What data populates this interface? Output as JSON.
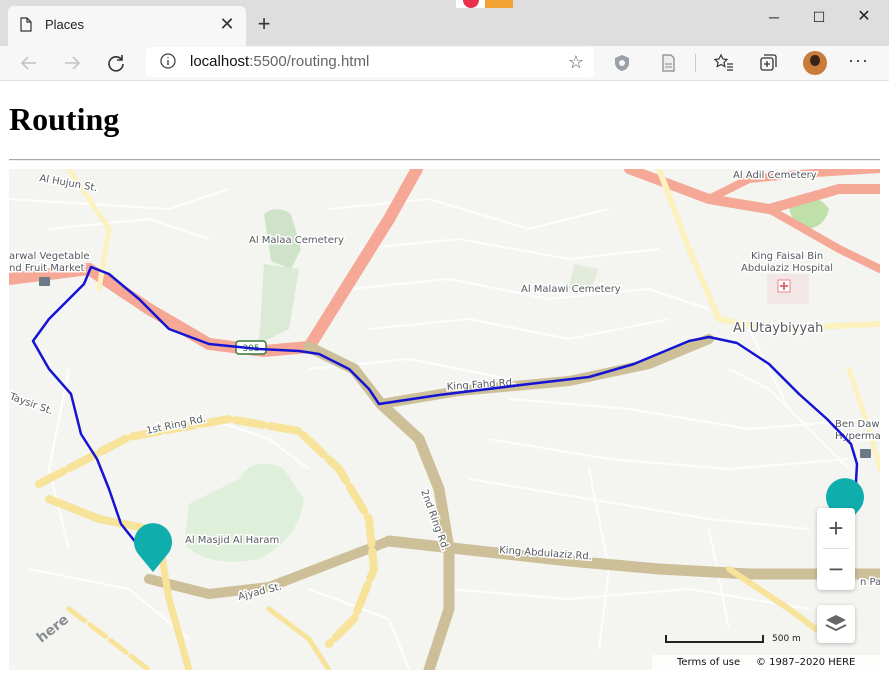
{
  "browser": {
    "tab_title": "Places",
    "tab_close_glyph": "✕",
    "new_tab_glyph": "+",
    "url_host": "localhost",
    "url_rest": ":5500/routing.html",
    "window_controls": {
      "minimize": "─",
      "maximize": "☐",
      "close": "✕"
    },
    "more_glyph": "···"
  },
  "page": {
    "title": "Routing"
  },
  "map": {
    "labels": {
      "al_hujun": "Al Hujun St.",
      "al_malaa": "Al Malaa Cemetery",
      "al_adil": "Al Adil Cemetery",
      "king_faisal_1": "King Faisal Bin",
      "king_faisal_2": "Abdulaziz Hospital",
      "al_malawi": "Al Malawi Cemetery",
      "al_utaybiyyah": "Al Utaybiyyah",
      "market_1": "arwal Vegetable",
      "market_2": "nd Fruit Market",
      "king_fahd": "King Fahd Rd.",
      "taysir": "Taysir St.",
      "first_ring": "1st Ring Rd.",
      "second_ring": "2nd Ring Rd.",
      "ben_dawood_1": "Ben Dawo",
      "ben_dawood_2": "Hypermar",
      "masjid": "Al Masjid Al Haram",
      "king_abdulaziz": "King Abdulaziz Rd.",
      "ajyad": "Ajyad St.",
      "shield": "305",
      "park_partial": "n Par"
    },
    "zoom_in": "+",
    "zoom_out": "−",
    "scale_label": "500 m",
    "terms": "Terms of use",
    "copyright": "© 1987–2020 HERE",
    "logo": "here",
    "route_color": "#1414d2",
    "marker_color": "#10adad"
  }
}
